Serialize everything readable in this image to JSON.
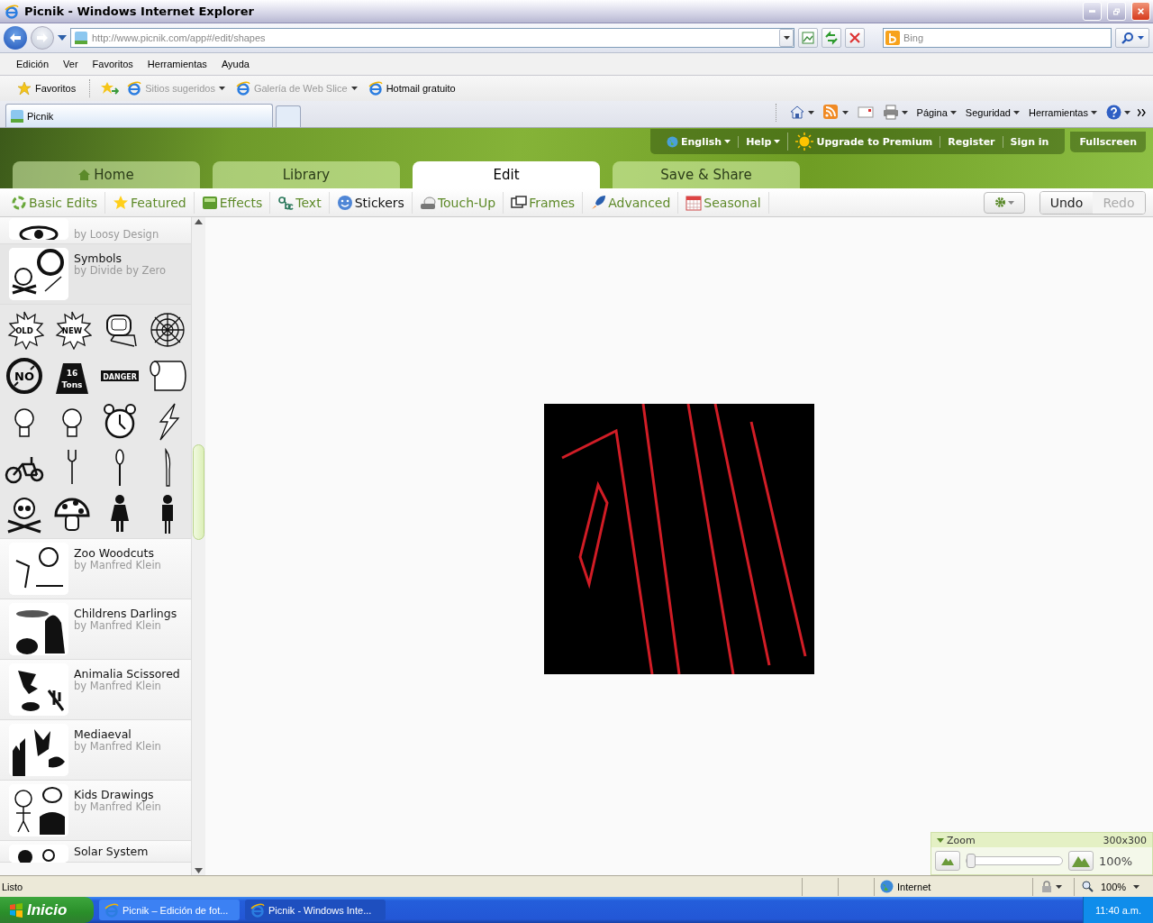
{
  "window": {
    "title": "Picnik - Windows Internet Explorer"
  },
  "address_bar": {
    "url": "http://www.picnik.com/app#/edit/shapes"
  },
  "search": {
    "placeholder": "Bing"
  },
  "menu": [
    "Edición",
    "Ver",
    "Favoritos",
    "Herramientas",
    "Ayuda"
  ],
  "favorites_bar": {
    "label": "Favoritos",
    "links": [
      {
        "label": "Sitios sugeridos",
        "dropdown": true,
        "dimmed": true
      },
      {
        "label": "Galería de Web Slice",
        "dropdown": true,
        "dimmed": true
      },
      {
        "label": "Hotmail gratuito",
        "dropdown": false,
        "dimmed": false
      }
    ]
  },
  "browser_tabs": [
    {
      "label": "Picnik",
      "selected": true
    }
  ],
  "command_bar": [
    "Página",
    "Seguridad",
    "Herramientas"
  ],
  "picnik": {
    "top_links": [
      {
        "label": "English",
        "dropdown": true
      },
      {
        "label": "Help",
        "dropdown": true
      },
      {
        "label": "Upgrade to Premium",
        "dropdown": false
      },
      {
        "label": "Register",
        "dropdown": false
      },
      {
        "label": "Sign in",
        "dropdown": false
      }
    ],
    "fullscreen": "Fullscreen",
    "main_tabs": [
      {
        "label": "Home",
        "selected": false
      },
      {
        "label": "Library",
        "selected": false
      },
      {
        "label": "Edit",
        "selected": true
      },
      {
        "label": "Save & Share",
        "selected": false
      }
    ],
    "tools": [
      {
        "label": "Basic Edits",
        "selected": false
      },
      {
        "label": "Featured",
        "selected": false
      },
      {
        "label": "Effects",
        "selected": false
      },
      {
        "label": "Text",
        "selected": false
      },
      {
        "label": "Stickers",
        "selected": true
      },
      {
        "label": "Touch-Up",
        "selected": false
      },
      {
        "label": "Frames",
        "selected": false
      },
      {
        "label": "Advanced",
        "selected": false
      },
      {
        "label": "Seasonal",
        "selected": false
      }
    ],
    "undo": {
      "label": "Undo",
      "disabled": false
    },
    "redo": {
      "label": "Redo",
      "disabled": true
    }
  },
  "sidebar": {
    "items": [
      {
        "kind": "pack",
        "author": "by Loosy Design",
        "expanded": false
      },
      {
        "kind": "pack",
        "title": "Symbols",
        "author": "by Divide by Zero",
        "expanded": true
      },
      {
        "kind": "grid",
        "stickers": [
          {
            "kind": "burst",
            "text": "OLD"
          },
          {
            "kind": "burst",
            "text": "NEW"
          },
          {
            "kind": "computer"
          },
          {
            "kind": "web"
          },
          {
            "kind": "nosign",
            "text": "NO"
          },
          {
            "kind": "weight",
            "text": "16 Tons"
          },
          {
            "kind": "banner",
            "text": "DANGER"
          },
          {
            "kind": "roll"
          },
          {
            "kind": "bulb"
          },
          {
            "kind": "bulb"
          },
          {
            "kind": "clock"
          },
          {
            "kind": "bolt"
          },
          {
            "kind": "bicycle"
          },
          {
            "kind": "fork"
          },
          {
            "kind": "spoon"
          },
          {
            "kind": "knife"
          },
          {
            "kind": "skull"
          },
          {
            "kind": "mushroom"
          },
          {
            "kind": "woman"
          },
          {
            "kind": "man"
          }
        ]
      },
      {
        "kind": "pack",
        "title": "Zoo Woodcuts",
        "author": "by Manfred Klein",
        "expanded": false
      },
      {
        "kind": "pack",
        "title": "Childrens Darlings",
        "author": "by Manfred Klein",
        "expanded": false
      },
      {
        "kind": "pack",
        "title": "Animalia Scissored",
        "author": "by Manfred Klein",
        "expanded": false
      },
      {
        "kind": "pack",
        "title": "Mediaeval",
        "author": "by Manfred Klein",
        "expanded": false
      },
      {
        "kind": "pack",
        "title": "Kids Drawings",
        "author": "by Manfred Klein",
        "expanded": false
      },
      {
        "kind": "pack",
        "title": "Solar System",
        "expanded": false
      }
    ]
  },
  "zoom": {
    "label": "Zoom",
    "size": "300x300",
    "level": 0.0,
    "reading": "100%"
  },
  "status_bar": {
    "text": "Listo",
    "zone": "Internet",
    "zoom": "100%"
  },
  "taskbar": {
    "start": "Inicio",
    "tasks": [
      {
        "label": "Picnik – Edición de fot...",
        "selected": false
      },
      {
        "label": "Picnik - Windows Inte...",
        "selected": true
      }
    ],
    "clock": "11:40 a.m."
  }
}
